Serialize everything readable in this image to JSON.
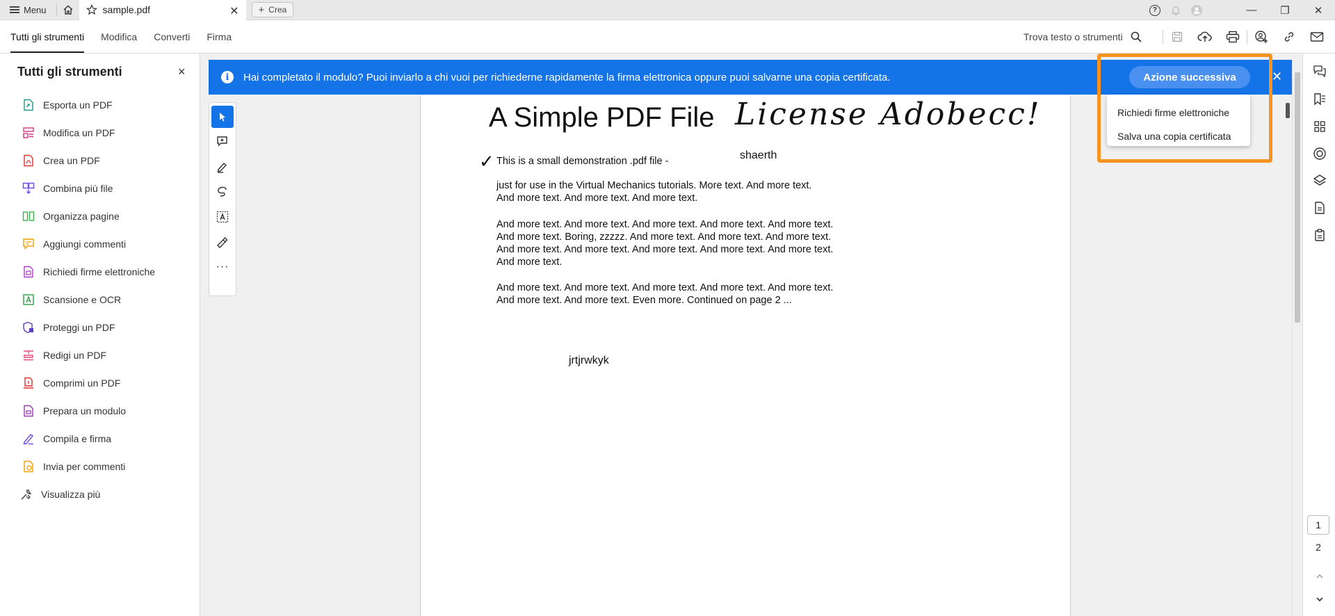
{
  "titlebar": {
    "menu_label": "Menu",
    "tab_title": "sample.pdf",
    "tab_close": "✕",
    "create_label": "Crea",
    "help_glyph": "?",
    "minimize": "—",
    "maximize": "❐",
    "close": "✕"
  },
  "toolbar": {
    "tabs": [
      "Tutti gli strumenti",
      "Modifica",
      "Converti",
      "Firma"
    ],
    "find_label": "Trova testo o strumenti"
  },
  "left_panel": {
    "title": "Tutti gli strumenti",
    "close": "×",
    "items": [
      {
        "label": "Esporta un PDF",
        "color": "#1a9a8a"
      },
      {
        "label": "Modifica un PDF",
        "color": "#d63384"
      },
      {
        "label": "Crea un PDF",
        "color": "#e03131"
      },
      {
        "label": "Combina più file",
        "color": "#7048e8"
      },
      {
        "label": "Organizza pagine",
        "color": "#37b24d"
      },
      {
        "label": "Aggiungi commenti",
        "color": "#f59f00"
      },
      {
        "label": "Richiedi firme elettroniche",
        "color": "#ae3ec9"
      },
      {
        "label": "Scansione e OCR",
        "color": "#2f9e44"
      },
      {
        "label": "Proteggi un PDF",
        "color": "#5f3dc4"
      },
      {
        "label": "Redigi un PDF",
        "color": "#e64980"
      },
      {
        "label": "Comprimi un PDF",
        "color": "#e03131"
      },
      {
        "label": "Prepara un modulo",
        "color": "#9c36b5"
      },
      {
        "label": "Compila e firma",
        "color": "#7048e8"
      },
      {
        "label": "Invia per commenti",
        "color": "#f59f00"
      },
      {
        "label": "Visualizza più",
        "color": "#444444"
      }
    ]
  },
  "banner": {
    "info_glyph": "i",
    "message": "Hai completato il modulo? Puoi inviarlo a chi vuoi per richiederne rapidamente la firma elettronica oppure puoi salvarne una copia certificata.",
    "next_action": "Azione successiva",
    "close": "✕",
    "dropdown": [
      "Richiedi firme elettroniche",
      "Salva una copia certificata"
    ]
  },
  "pdf": {
    "title": "A Simple PDF File",
    "signature": "License Adobecc!",
    "check": "✓",
    "line1": "This is a small demonstration .pdf file -",
    "annotation1": "shaerth",
    "para1": "just for use in the Virtual Mechanics tutorials. More text. And more text. And more text. And more text. And more text.",
    "para2": "And more text. And more text. And more text. And more text. And more text. And more text. Boring, zzzzz. And more text. And more text. And more text. And more text. And more text. And more text. And more text. And more text. And more text.",
    "para3": "And more text. And more text. And more text. And more text. And more text. And more text. And more text. Even more. Continued on page 2 ...",
    "annotation2": "jrtjrwkyk"
  },
  "pages": {
    "current": "1",
    "next": "2"
  },
  "colors": {
    "accent": "#1473e6",
    "highlight": "#f7931e",
    "button": "#4a90f0"
  }
}
